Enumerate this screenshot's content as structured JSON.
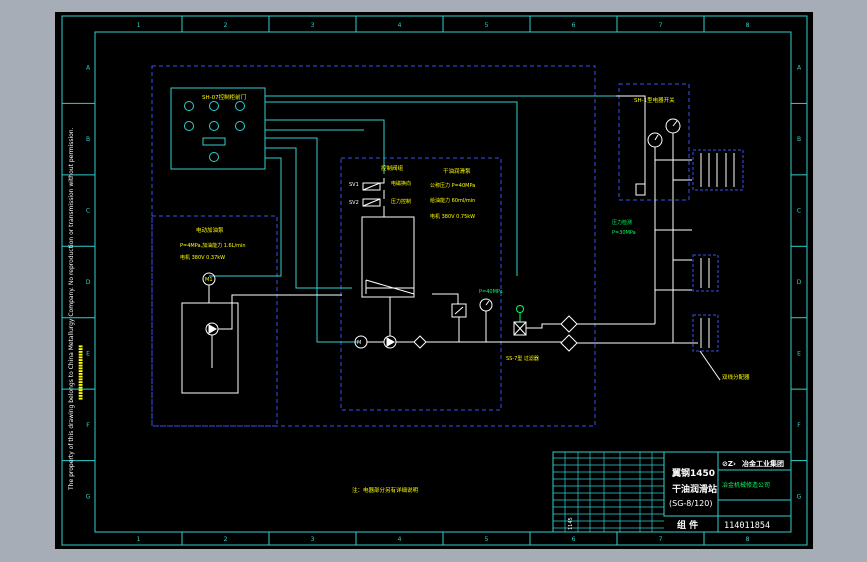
{
  "colors": {
    "background": "#a7adb7",
    "sheet": "#000000",
    "border": "#2fd0d0",
    "dashed_frame": "#3b4ff0",
    "wire": "#ffffff",
    "label": "#ffff00",
    "pipe_green": "#00ff60"
  },
  "border": {
    "rows": [
      "A",
      "B",
      "C",
      "D",
      "E",
      "F",
      "G"
    ],
    "cols": [
      "1",
      "2",
      "3",
      "4",
      "5",
      "6",
      "7",
      "8"
    ]
  },
  "components": {
    "control_cabinet_title": "SH-07控制柜前门",
    "electric_cabinet_title": "SH-1型电器开关",
    "valve_group_title": "控制阀组",
    "valve_sv1": "SV1",
    "valve_sv2": "SV2",
    "valve_note_1": "电磁换向",
    "valve_note_2": "压力控制",
    "oil_station_title": "干油润滑泵",
    "oil_station_lines": [
      "公称压力 P=40MPa",
      "给油能力 60ml/min",
      "电机 380V 0.75kW"
    ],
    "pump_station_title": "电动加油泵",
    "pump_station_lines": [
      "P=4MPa,加油能力 1.6L/min",
      "电机 380V 0.37kW"
    ],
    "pump_tag": "M1",
    "pressure_tag": "P=40MPa",
    "line_filter_label": "SS-7型 过滤器",
    "distributor_note_1": "压力检测",
    "distributor_note_2": "P=30MPa",
    "distributor_label": "双线分配器",
    "bottom_note": "注：电器部分另有详细说明"
  },
  "title_block": {
    "product_line_1": "翼钢1450",
    "product_line_2": "干油润滑站",
    "product_line_3": "(SG-8/120)",
    "company": "冶金工业集团",
    "sub_company": "冶金机械修造公司",
    "category": "组  件",
    "drawing_no": "114011854",
    "side_code": "1145"
  },
  "side_notice": "The property of this drawing belongs to China Metallurgy Company. No reproduction or transmission without permission."
}
